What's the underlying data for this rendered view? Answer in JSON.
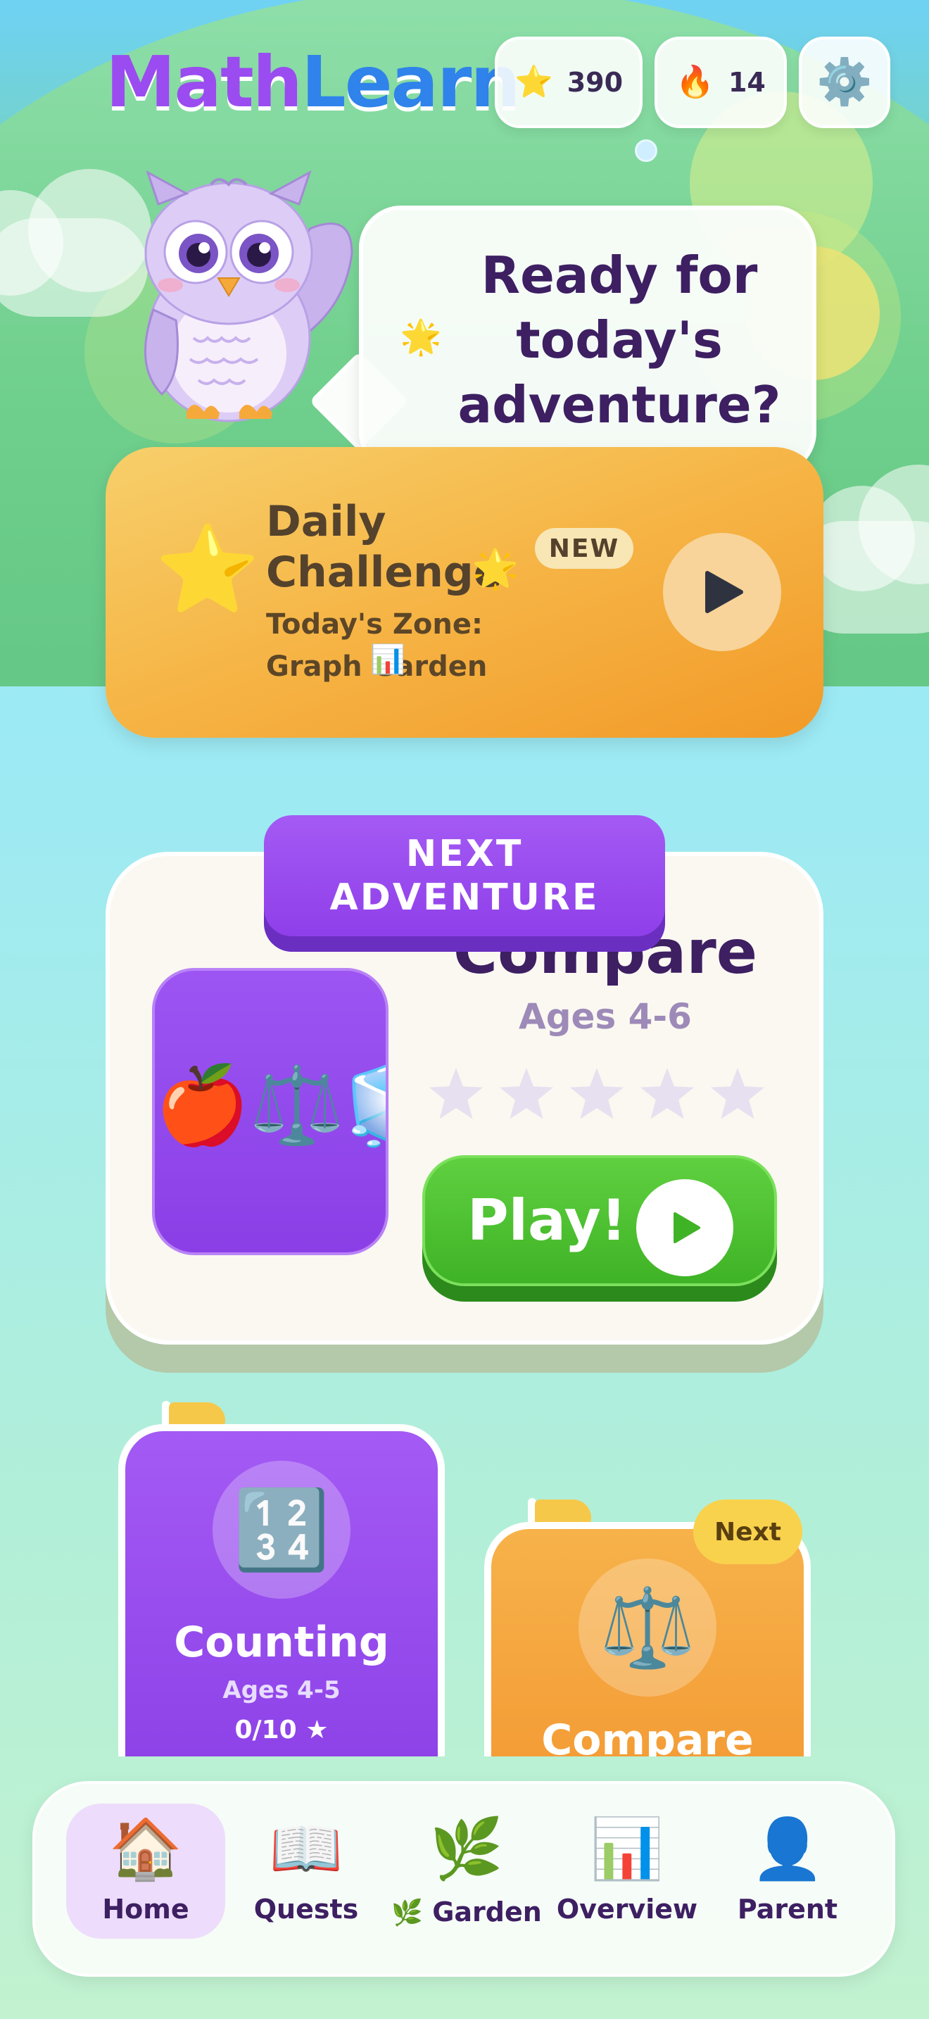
{
  "app": {
    "logo_part1": "Math",
    "logo_part2": "Learn"
  },
  "header": {
    "stars": {
      "icon": "star-icon",
      "value": "390"
    },
    "streak": {
      "icon": "fire-icon",
      "value": "14"
    },
    "settings": {
      "icon": "gear-icon"
    }
  },
  "greeting": {
    "text": "Ready for today's adventure?",
    "icon": "sparkle-icon"
  },
  "daily_challenge": {
    "title": "Daily Challenge",
    "badge": "NEW",
    "subtitle": "Today's Zone: Graph Garden",
    "icons": [
      "star-icon",
      "sparkle-icon",
      "bar-chart-icon",
      "play-icon"
    ]
  },
  "next_adventure": {
    "tab_label": "NEXT ADVENTURE",
    "title": "Compare",
    "ages": "Ages 4-6",
    "stars_earned": 0,
    "stars_total": 5,
    "play_label": "Play!",
    "thumb_icons": [
      "apple-icon",
      "scales-icon",
      "ice-cube-icon"
    ]
  },
  "skills": [
    {
      "name": "Counting",
      "ages": "Ages 4-5",
      "progress": "0/10 ★",
      "progress_fraction": 0.0,
      "icon": "numbers-1234-icon",
      "color": "#9a4cf0"
    },
    {
      "name": "Compare",
      "badge": "Next",
      "icon": "scales-icon",
      "color": "#f59a30"
    }
  ],
  "nav": {
    "items": [
      {
        "label": "Home",
        "icon": "house-icon",
        "active": true
      },
      {
        "label": "Quests",
        "icon": "book-icon",
        "active": false
      },
      {
        "label": "Garden",
        "icon": "herb-icon",
        "active": false
      },
      {
        "label": "Overview",
        "icon": "bar-chart-icon",
        "active": false
      },
      {
        "label": "Parent",
        "icon": "person-icon",
        "active": false
      }
    ]
  },
  "colors": {
    "purple": "#9a4cf0",
    "blue": "#2f83ea",
    "orange": "#f6b748",
    "green": "#44b82a",
    "text_dark": "#3d1f62"
  }
}
